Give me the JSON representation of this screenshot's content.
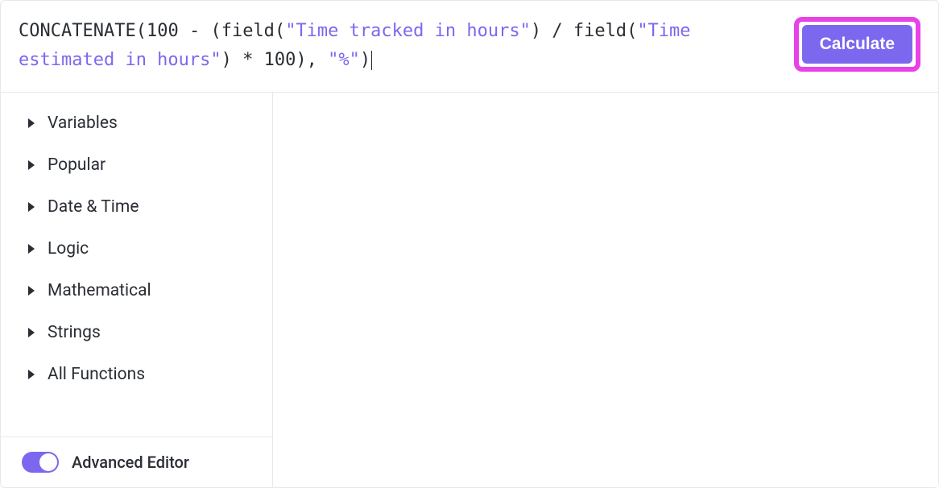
{
  "formula": {
    "tokens": [
      {
        "t": "fn",
        "v": "CONCATENATE"
      },
      {
        "t": "punc",
        "v": "("
      },
      {
        "t": "num",
        "v": "100"
      },
      {
        "t": "punc",
        "v": " - "
      },
      {
        "t": "punc",
        "v": "("
      },
      {
        "t": "fn",
        "v": "field"
      },
      {
        "t": "punc",
        "v": "("
      },
      {
        "t": "str",
        "v": "\"Time tracked in hours\""
      },
      {
        "t": "punc",
        "v": ")"
      },
      {
        "t": "punc",
        "v": " / "
      },
      {
        "t": "fn",
        "v": "field"
      },
      {
        "t": "punc",
        "v": "("
      },
      {
        "t": "str",
        "v": "\"Time estimated in hours\""
      },
      {
        "t": "punc",
        "v": ")"
      },
      {
        "t": "punc",
        "v": " * "
      },
      {
        "t": "num",
        "v": "100"
      },
      {
        "t": "punc",
        "v": ")"
      },
      {
        "t": "punc",
        "v": ", "
      },
      {
        "t": "str",
        "v": "\"%\""
      },
      {
        "t": "punc",
        "v": ")"
      }
    ]
  },
  "buttons": {
    "calculate": "Calculate"
  },
  "sidebar": {
    "categories": [
      {
        "label": "Variables"
      },
      {
        "label": "Popular"
      },
      {
        "label": "Date & Time"
      },
      {
        "label": "Logic"
      },
      {
        "label": "Mathematical"
      },
      {
        "label": "Strings"
      },
      {
        "label": "All Functions"
      }
    ],
    "advanced_editor_label": "Advanced Editor",
    "advanced_editor_on": true
  },
  "colors": {
    "accent": "#7b68ee",
    "highlight_border": "#e841e8",
    "text": "#2a2e34",
    "error": "#e04f4f"
  }
}
